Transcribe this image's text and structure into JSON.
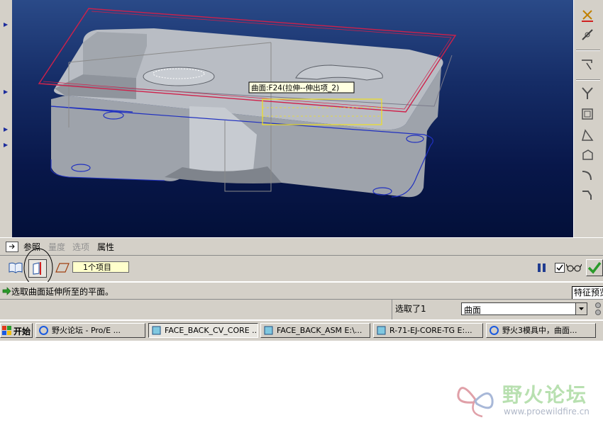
{
  "viewport": {
    "tooltip": "曲面:F24(拉伸--伸出项_2)"
  },
  "tabs": [
    {
      "label": "参照",
      "enabled": true
    },
    {
      "label": "量度",
      "enabled": false
    },
    {
      "label": "选项",
      "enabled": false
    },
    {
      "label": "属性",
      "enabled": true
    }
  ],
  "dashboard": {
    "collector_value": "1个项目"
  },
  "message": {
    "text": "选取曲面延伸所至的平面。",
    "right_button": "特征预览"
  },
  "status": {
    "selected_text": "选取了1",
    "filter_value": "曲面"
  },
  "taskbar": {
    "start_label": "开始",
    "tasks": [
      {
        "label": "野火论坛 - Pro/E ..."
      },
      {
        "label": "FACE_BACK_CV_CORE ..."
      },
      {
        "label": "FACE_BACK_ASM E:\\..."
      },
      {
        "label": "R-71-EJ-CORE-TG E:..."
      },
      {
        "label": "野火3模具中，曲面..."
      }
    ]
  },
  "watermark": {
    "title": "野火论坛",
    "url": "www.proewildfire.cn"
  },
  "colors": {
    "accent_green": "#2a9a2a",
    "viewport_dark": "#031039",
    "part_gray": "#a8acb4",
    "highlight_red": "#d0204a",
    "yellow_select": "#f0e020"
  }
}
